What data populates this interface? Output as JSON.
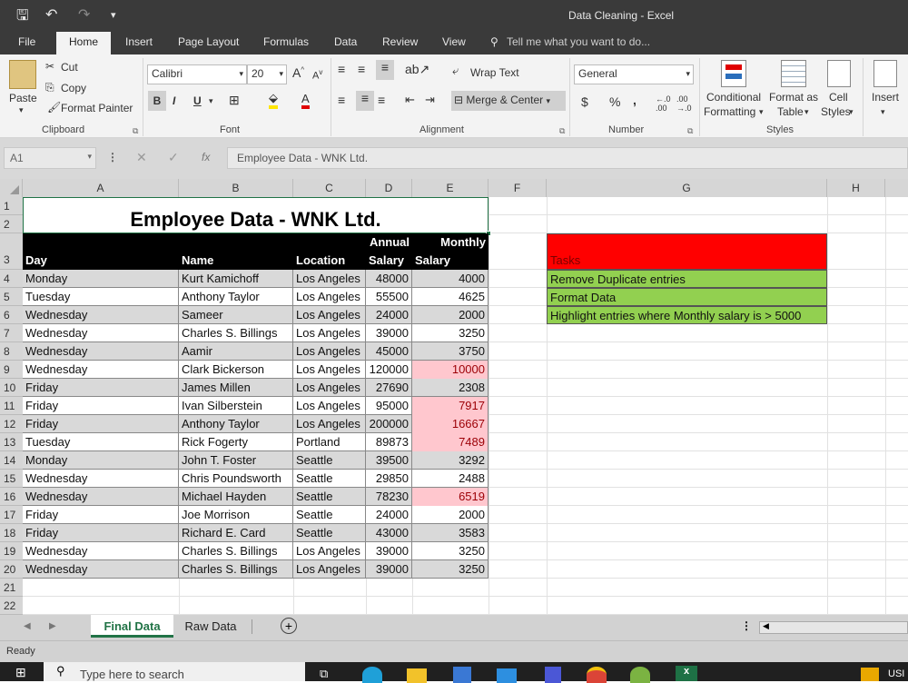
{
  "window": {
    "title": "Data Cleaning - Excel"
  },
  "ribbon_tabs": [
    "File",
    "Home",
    "Insert",
    "Page Layout",
    "Formulas",
    "Data",
    "Review",
    "View"
  ],
  "tell_me": "Tell me what you want to do...",
  "clipboard": {
    "paste": "Paste",
    "cut": "Cut",
    "copy": "Copy",
    "format_painter": "Format Painter",
    "label": "Clipboard"
  },
  "font": {
    "name": "Calibri",
    "size": "20",
    "label": "Font",
    "bold": "B",
    "italic": "I",
    "underline": "U"
  },
  "alignment": {
    "wrap": "Wrap Text",
    "merge": "Merge & Center",
    "label": "Alignment"
  },
  "number": {
    "format": "General",
    "label": "Number",
    "currency": "$",
    "percent": "%",
    "comma": ","
  },
  "styles": {
    "conditional": "Conditional",
    "conditional2": "Formatting",
    "format_as": "Format as",
    "format_as2": "Table",
    "cell": "Cell",
    "cell2": "Styles",
    "label": "Styles"
  },
  "cells_group": {
    "insert": "Insert"
  },
  "formula_bar": {
    "name_box": "A1",
    "fx": "fx",
    "content": "Employee Data - WNK Ltd."
  },
  "columns": [
    "A",
    "B",
    "C",
    "D",
    "E",
    "F",
    "G",
    "H"
  ],
  "rows": [
    "1",
    "2",
    "3",
    "4",
    "5",
    "6",
    "7",
    "8",
    "9",
    "10",
    "11",
    "12",
    "13",
    "14",
    "15",
    "16",
    "17",
    "18",
    "19",
    "20",
    "21",
    "22"
  ],
  "sheet_title": "Employee Data - WNK Ltd.",
  "headers": {
    "day": "Day",
    "name": "Name",
    "location": "Location",
    "annual1": "Annual",
    "annual2": "Salary",
    "monthly1": "Monthly",
    "monthly2": "Salary"
  },
  "records": [
    [
      "Monday",
      "Kurt Kamichoff",
      "Los Angeles",
      "48000",
      "4000"
    ],
    [
      "Tuesday",
      "Anthony Taylor",
      "Los Angeles",
      "55500",
      "4625"
    ],
    [
      "Wednesday",
      "Sameer",
      "Los Angeles",
      "24000",
      "2000"
    ],
    [
      "Wednesday",
      "Charles S. Billings",
      "Los Angeles",
      "39000",
      "3250"
    ],
    [
      "Wednesday",
      "Aamir",
      "Los Angeles",
      "45000",
      "3750"
    ],
    [
      "Wednesday",
      "Clark Bickerson",
      "Los Angeles",
      "120000",
      "10000"
    ],
    [
      "Friday",
      "James Millen",
      "Los Angeles",
      "27690",
      "2308"
    ],
    [
      "Friday",
      "Ivan Silberstein",
      "Los Angeles",
      "95000",
      "7917"
    ],
    [
      "Friday",
      "Anthony Taylor",
      "Los Angeles",
      "200000",
      "16667"
    ],
    [
      "Tuesday",
      "Rick Fogerty",
      "Portland",
      "89873",
      "7489"
    ],
    [
      "Monday",
      "John T. Foster",
      "Seattle",
      "39500",
      "3292"
    ],
    [
      "Wednesday",
      "Chris Poundsworth",
      "Seattle",
      "29850",
      "2488"
    ],
    [
      "Wednesday",
      "Michael Hayden",
      "Seattle",
      "78230",
      "6519"
    ],
    [
      "Friday",
      "Joe Morrison",
      "Seattle",
      "24000",
      "2000"
    ],
    [
      "Friday",
      "Richard E. Card",
      "Seattle",
      "43000",
      "3583"
    ],
    [
      "Wednesday",
      "Charles S. Billings",
      "Los Angeles",
      "39000",
      "3250"
    ],
    [
      "Wednesday",
      "Charles S. Billings",
      "Los Angeles",
      "39000",
      "3250"
    ]
  ],
  "tasks": [
    "Tasks",
    "Remove Duplicate entries",
    "Format Data",
    "Highlight entries where Monthly salary is > 5000"
  ],
  "sheets": [
    "Final Data",
    "Raw Data"
  ],
  "status": "Ready",
  "taskbar": {
    "search": "Type here to search",
    "lang": "USI"
  },
  "colors": {
    "header_bg": "#000000",
    "row_alt": "#d9d9d9",
    "highlight": "#ffc7ce",
    "highlight_text": "#9c0006",
    "task_header": "#ff0000",
    "task_row": "#92d050",
    "active": "#217346"
  }
}
